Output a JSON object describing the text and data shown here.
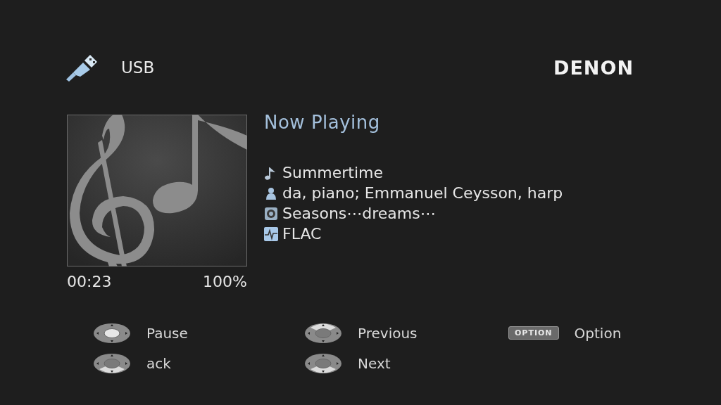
{
  "header": {
    "source": "USB",
    "brand": "DENON"
  },
  "now_playing": {
    "title": "Now Playing",
    "time": "00:23",
    "volume": "100%",
    "info": [
      {
        "kind": "track",
        "text": "Summertime"
      },
      {
        "kind": "artist",
        "text": "da, piano; Emmanuel Ceysson, harp"
      },
      {
        "kind": "album",
        "text": "Seasons⋯dreams⋯"
      },
      {
        "kind": "format",
        "text": "FLAC"
      }
    ]
  },
  "legend": [
    {
      "kind": "enter",
      "label": "Pause"
    },
    {
      "kind": "up",
      "label": "Previous"
    },
    {
      "kind": "option",
      "key": "OPTION",
      "label": "Option"
    },
    {
      "kind": "down-left",
      "label": "ack"
    },
    {
      "kind": "down",
      "label": "Next"
    }
  ]
}
